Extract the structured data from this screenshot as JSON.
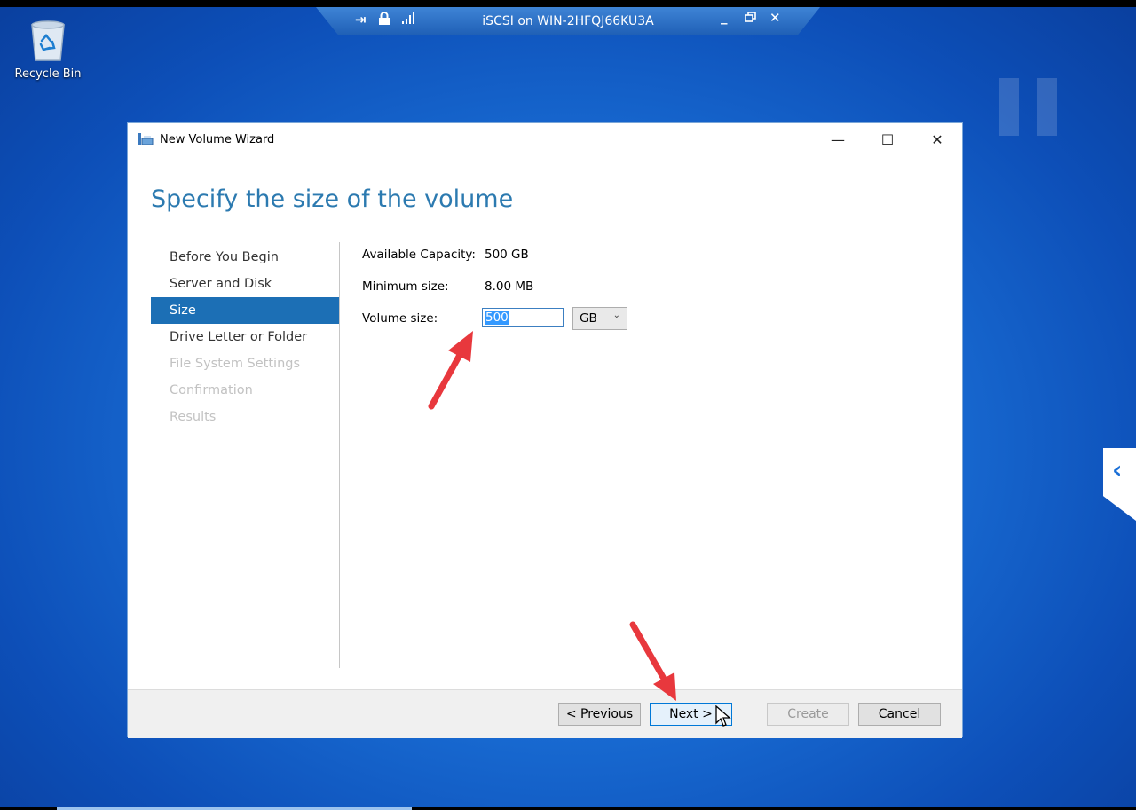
{
  "remote_bar": {
    "title": "iSCSI on WIN-2HFQJ66KU3A",
    "icons": [
      "pin-icon",
      "lock-icon",
      "signal-icon",
      "minimize-icon",
      "restore-icon",
      "close-icon"
    ]
  },
  "desktop": {
    "recycle_bin_label": "Recycle Bin"
  },
  "window": {
    "title": "New Volume Wizard",
    "heading": "Specify the size of the volume",
    "nav": [
      {
        "label": "Before You Begin",
        "state": "normal"
      },
      {
        "label": "Server and Disk",
        "state": "normal"
      },
      {
        "label": "Size",
        "state": "active"
      },
      {
        "label": "Drive Letter or Folder",
        "state": "normal"
      },
      {
        "label": "File System Settings",
        "state": "disabled"
      },
      {
        "label": "Confirmation",
        "state": "disabled"
      },
      {
        "label": "Results",
        "state": "disabled"
      }
    ],
    "fields": {
      "available_capacity_label": "Available Capacity:",
      "available_capacity_value": "500 GB",
      "minimum_size_label": "Minimum size:",
      "minimum_size_value": "8.00 MB",
      "volume_size_label": "Volume size:",
      "volume_size_value": "500",
      "unit_selected": "GB"
    },
    "buttons": {
      "previous": "< Previous",
      "next": "Next >",
      "create": "Create",
      "cancel": "Cancel"
    }
  },
  "colors": {
    "accent": "#1c6fb5",
    "heading": "#2c7ab0",
    "annotation_arrow": "#e8383d"
  }
}
